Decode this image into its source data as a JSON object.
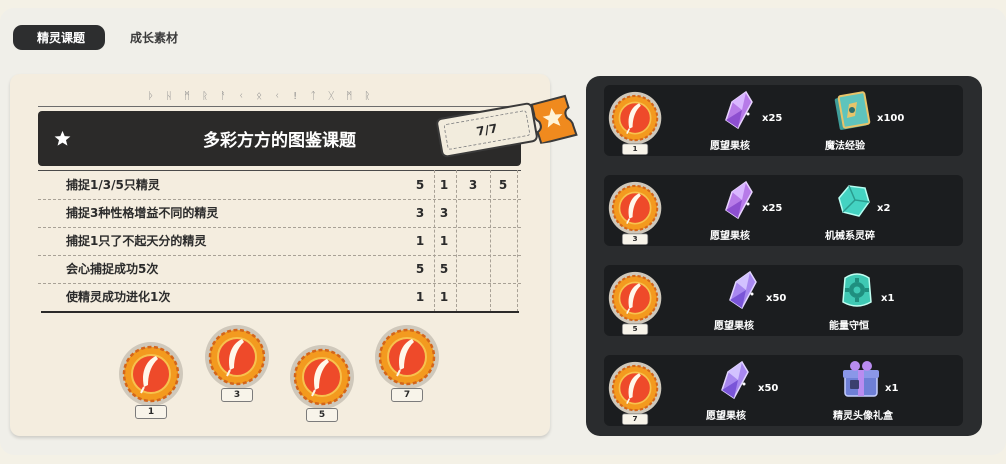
{
  "tabs": [
    {
      "label": "精灵课题",
      "active": true
    },
    {
      "label": "成长素材",
      "active": false
    }
  ],
  "rune_text": "ᚦ ᚺ ᛗ  ᚱ ᚨ ᚲ ᛟ  ᚲ ! ᛏ ᚷ ᛗ ᚱ",
  "title": "多彩方方的图鉴课题",
  "progress": "7/7",
  "tasks": [
    {
      "label": "捕捉1/3/5只精灵",
      "values": [
        "5",
        "1",
        "3",
        "5"
      ]
    },
    {
      "label": "捕捉3种性格增益不同的精灵",
      "values": [
        "3",
        "3",
        "",
        ""
      ]
    },
    {
      "label": "捕捉1只了不起天分的精灵",
      "values": [
        "1",
        "1",
        "",
        ""
      ]
    },
    {
      "label": "会心捕捉成功5次",
      "values": [
        "5",
        "5",
        "",
        ""
      ]
    },
    {
      "label": "使精灵成功进化1次",
      "values": [
        "1",
        "1",
        "",
        ""
      ]
    }
  ],
  "milestones": [
    "1",
    "3",
    "5",
    "7"
  ],
  "rewards": [
    {
      "milestone": "1",
      "items": [
        {
          "name": "愿望果核",
          "count": "x25",
          "icon": "crystal-icon"
        },
        {
          "name": "魔法经验",
          "count": "x100",
          "icon": "magic-book-icon"
        }
      ]
    },
    {
      "milestone": "3",
      "items": [
        {
          "name": "愿望果核",
          "count": "x25",
          "icon": "crystal-icon"
        },
        {
          "name": "机械系灵碎",
          "count": "x2",
          "icon": "mech-shard-icon"
        }
      ]
    },
    {
      "milestone": "5",
      "items": [
        {
          "name": "愿望果核",
          "count": "x50",
          "icon": "crystal-icon"
        },
        {
          "name": "能量守恒",
          "count": "x1",
          "icon": "gear-stone-icon"
        }
      ]
    },
    {
      "milestone": "7",
      "items": [
        {
          "name": "愿望果核",
          "count": "x50",
          "icon": "crystal-icon"
        },
        {
          "name": "精灵头像礼盒",
          "count": "x1",
          "icon": "gift-box-icon"
        }
      ]
    }
  ],
  "colors": {
    "dark_panel": "#2a2c2e",
    "paper": "#f4eddf",
    "accent_orange": "#f08a1e",
    "crystal_purple": "#b77be8"
  }
}
